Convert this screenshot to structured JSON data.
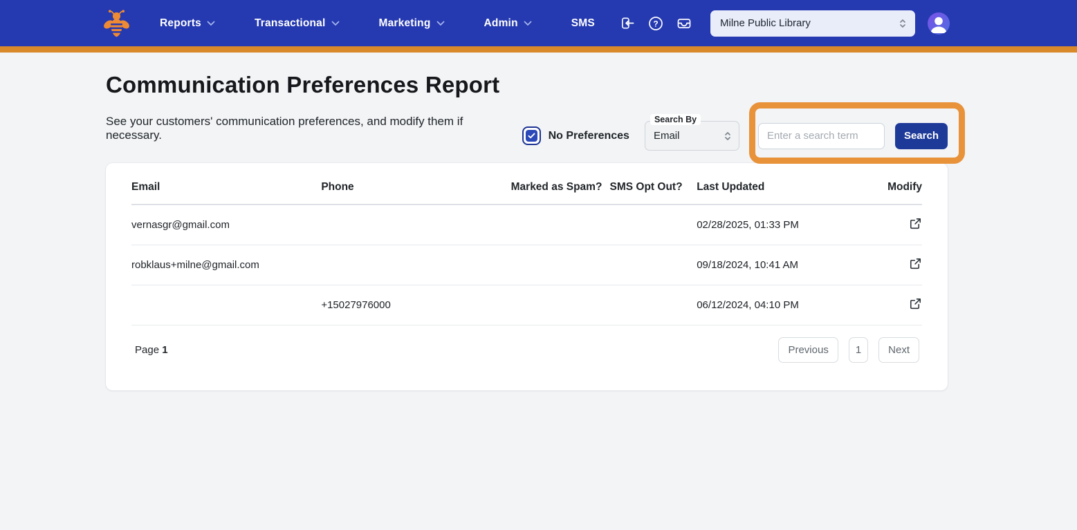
{
  "navbar": {
    "logo_name": "bee-logo",
    "items": [
      {
        "label": "Reports",
        "dropdown": true
      },
      {
        "label": "Transactional",
        "dropdown": true
      },
      {
        "label": "Marketing",
        "dropdown": true
      },
      {
        "label": "Admin",
        "dropdown": true
      },
      {
        "label": "SMS",
        "dropdown": false
      }
    ],
    "icons": [
      {
        "name": "login-icon"
      },
      {
        "name": "help-icon"
      },
      {
        "name": "inbox-icon"
      }
    ],
    "org_select_value": "Milne Public Library",
    "avatar_name": "user-avatar"
  },
  "page": {
    "title": "Communication Preferences Report",
    "subtitle": "See your customers' communication preferences, and modify them if necessary."
  },
  "filters": {
    "no_preferences_label": "No Preferences",
    "no_preferences_checked": true,
    "search_by_label": "Search By",
    "search_by_value": "Email",
    "search_placeholder": "Enter a search term",
    "search_button_label": "Search"
  },
  "table": {
    "columns": [
      "Email",
      "Phone",
      "Marked as Spam?",
      "SMS Opt Out?",
      "Last Updated",
      "Modify"
    ],
    "rows": [
      {
        "email": "vernasgr@gmail.com",
        "phone": "",
        "marked_as_spam": "",
        "sms_opt_out": "",
        "last_updated": "02/28/2025, 01:33 PM"
      },
      {
        "email": "robklaus+milne@gmail.com",
        "phone": "",
        "marked_as_spam": "",
        "sms_opt_out": "",
        "last_updated": "09/18/2024, 10:41 AM"
      },
      {
        "email": "",
        "phone": "+15027976000",
        "marked_as_spam": "",
        "sms_opt_out": "",
        "last_updated": "06/12/2024, 04:10 PM"
      }
    ]
  },
  "pagination": {
    "page_label": "Page",
    "page_number": "1",
    "previous_label": "Previous",
    "page_button_label": "1",
    "next_label": "Next"
  },
  "colors": {
    "navbar_blue": "#2539b0",
    "accent_orange": "#d9882a",
    "annotation_orange": "#e8923a",
    "primary_button_blue": "#1e3a99",
    "checkbox_blue": "#2b49b8",
    "page_background": "#f2f4f6"
  }
}
